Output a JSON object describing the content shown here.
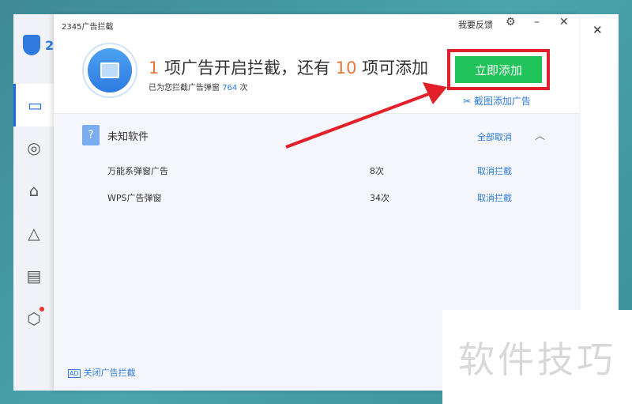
{
  "app": {
    "logo_text": "2",
    "title": "2345广告拦截",
    "feedback": "我要反馈"
  },
  "header": {
    "count_on": "1",
    "text1": " 项广告开启拦截，还有 ",
    "count_add": "10",
    "text2": " 项可添加",
    "sub_prefix": "已为您拦截广告弹窗 ",
    "sub_count": "764",
    "sub_suffix": " 次",
    "add_button": "立即添加",
    "screenshot_add": "截图添加广告"
  },
  "group": {
    "name": "未知软件",
    "cancel_all": "全部取消",
    "items": [
      {
        "name": "万能系弹窗广告",
        "count": "8次",
        "action": "取消拦截"
      },
      {
        "name": "WPS广告弹窗",
        "count": "34次",
        "action": "取消拦截"
      }
    ]
  },
  "footer": {
    "ad_badge": "AD",
    "close_ad": "关闭广告拦截"
  },
  "watermark": "软件技巧",
  "colors": {
    "accent": "#2d7be0",
    "button": "#20c35a",
    "highlight": "#e3202a",
    "number": "#e8773a"
  }
}
